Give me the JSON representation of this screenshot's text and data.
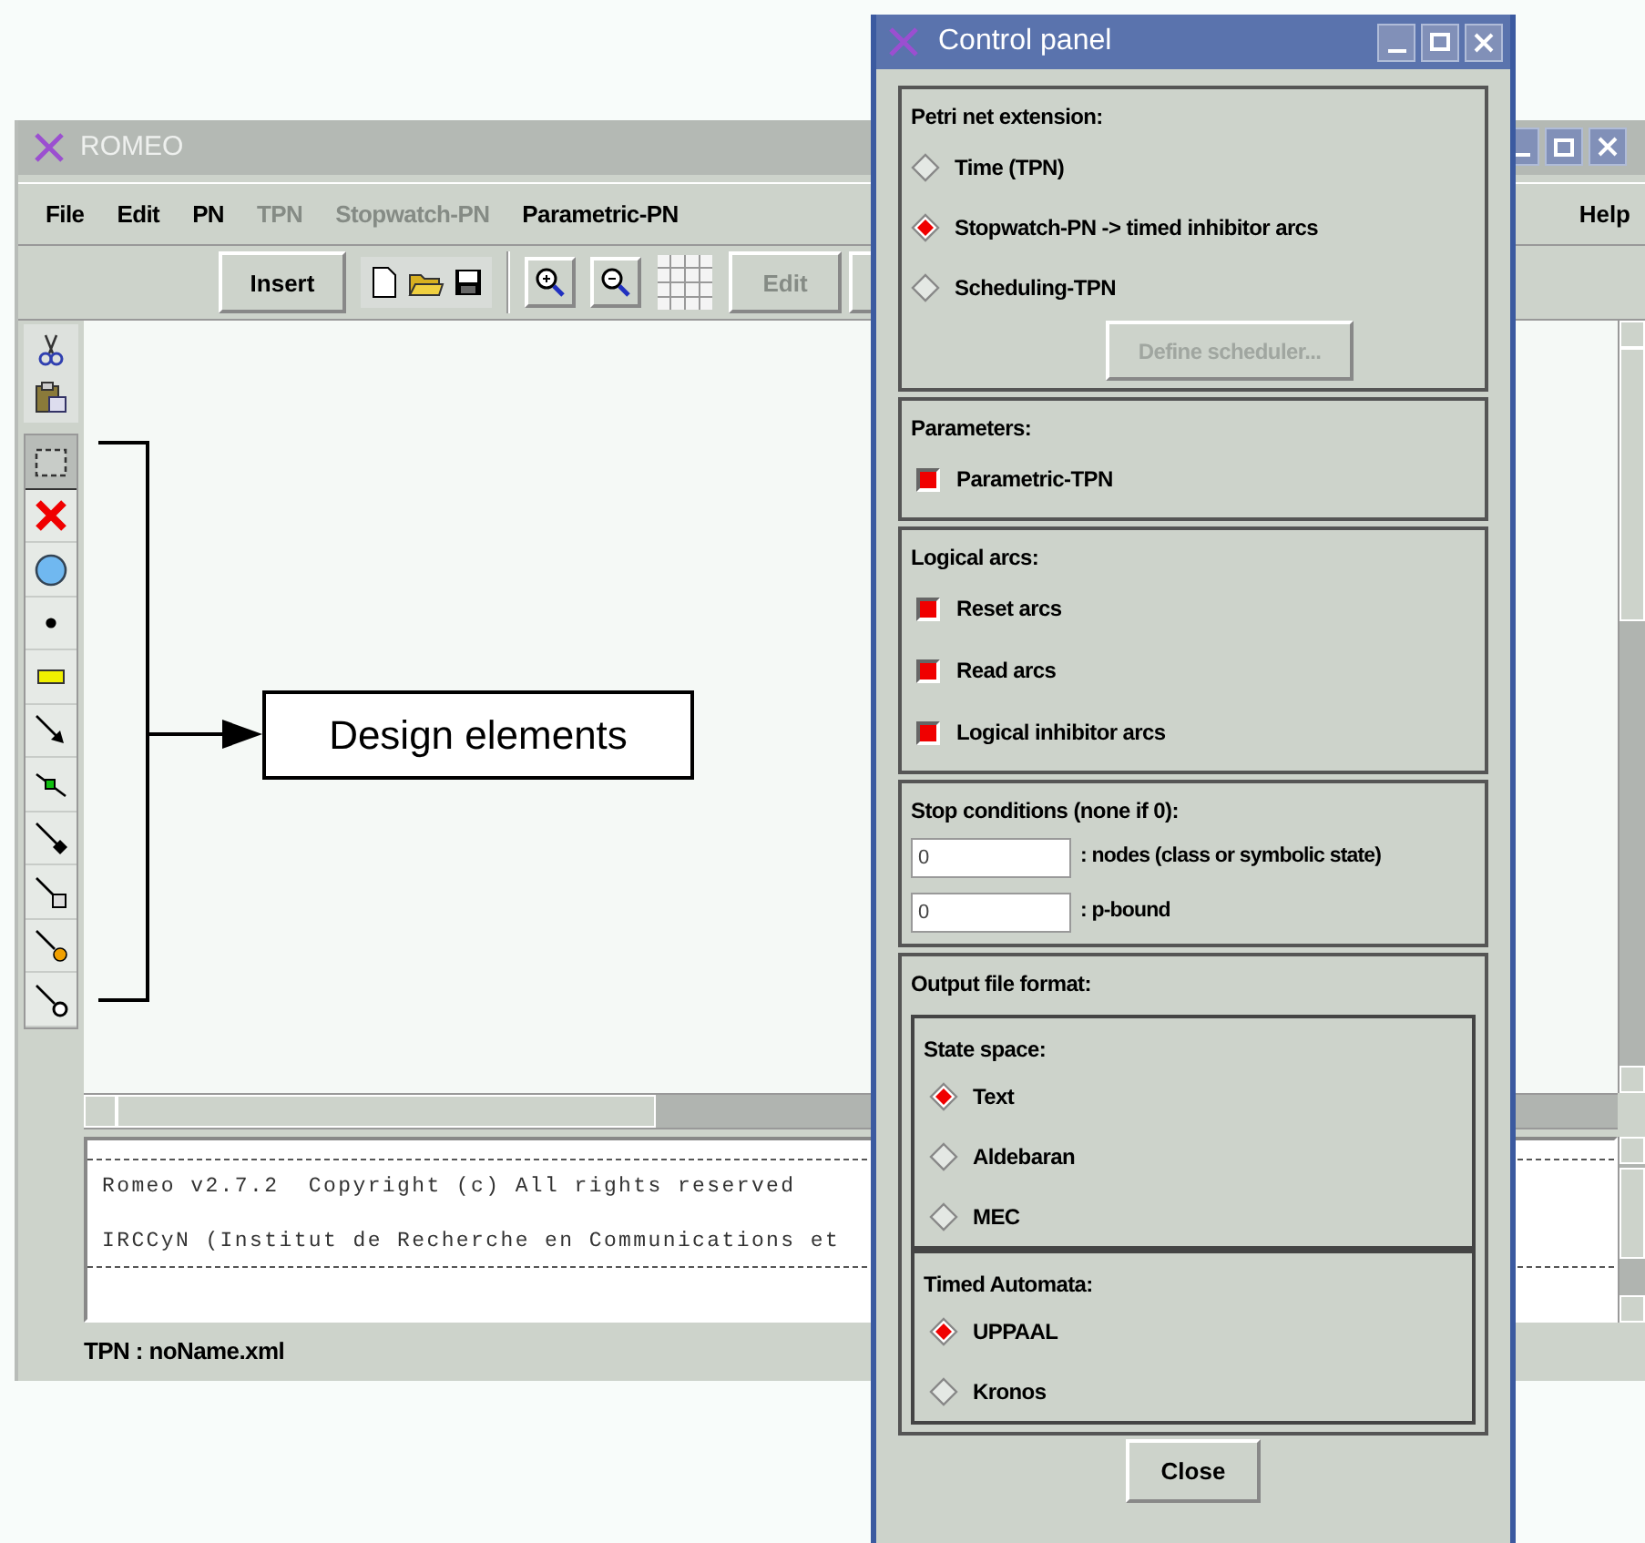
{
  "romeo": {
    "title": "ROMEO",
    "menu": [
      {
        "label": "File",
        "disabled": false
      },
      {
        "label": "Edit",
        "disabled": false
      },
      {
        "label": "PN",
        "disabled": false
      },
      {
        "label": "TPN",
        "disabled": true
      },
      {
        "label": "Stopwatch-PN",
        "disabled": true
      },
      {
        "label": "Parametric-PN",
        "disabled": false
      }
    ],
    "help_menu": "Help",
    "toolbar": {
      "insert": "Insert",
      "edit": {
        "label": "Edit",
        "disabled": true
      }
    },
    "edit_tools": [
      {
        "kind": "cut"
      },
      {
        "kind": "paste"
      }
    ],
    "design_tools": [
      {
        "kind": "select",
        "selected": true
      },
      {
        "kind": "delete",
        "selected": false
      },
      {
        "kind": "place",
        "selected": false
      },
      {
        "kind": "token",
        "selected": false
      },
      {
        "kind": "transition",
        "selected": false
      },
      {
        "kind": "arc",
        "selected": false
      },
      {
        "kind": "read_arc",
        "selected": false
      },
      {
        "kind": "diamond_arc",
        "selected": false
      },
      {
        "kind": "square_arc",
        "selected": false
      },
      {
        "kind": "orange_arc",
        "selected": false
      },
      {
        "kind": "hollow_arc",
        "selected": false
      }
    ],
    "console": [
      "Romeo v2.7.2  Copyright (c) All rights reserved",
      "IRCCyN (Institut de Recherche en Communications et"
    ],
    "status": "TPN : noName.xml"
  },
  "annotation": {
    "label": "Design elements"
  },
  "control_panel": {
    "title": "Control panel",
    "sections": [
      {
        "kind": "options",
        "title": "Petri net extension:",
        "items": [
          {
            "kind": "radio",
            "label": "Time (TPN)",
            "selected": false
          },
          {
            "kind": "radio",
            "label": "Stopwatch-PN -> timed inhibitor arcs",
            "selected": true
          },
          {
            "kind": "radio",
            "label": "Scheduling-TPN",
            "selected": false
          }
        ],
        "button": {
          "label": "Define scheduler...",
          "disabled": true
        }
      },
      {
        "kind": "options",
        "title": "Parameters:",
        "items": [
          {
            "kind": "checkbox",
            "label": "Parametric-TPN",
            "checked": true
          }
        ]
      },
      {
        "kind": "options",
        "title": "Logical arcs:",
        "items": [
          {
            "kind": "checkbox",
            "label": "Reset arcs",
            "checked": true
          },
          {
            "kind": "checkbox",
            "label": "Read arcs",
            "checked": true
          },
          {
            "kind": "checkbox",
            "label": "Logical inhibitor arcs",
            "checked": true
          }
        ]
      },
      {
        "kind": "fields",
        "title": "Stop conditions (none if 0):",
        "fields": [
          {
            "value": "0",
            "label": ": nodes (class or symbolic state)"
          },
          {
            "value": "0",
            "label": ": p-bound"
          }
        ]
      },
      {
        "kind": "groups",
        "title": "Output file format:",
        "groups": [
          {
            "title": "State space:",
            "items": [
              {
                "kind": "radio",
                "label": "Text",
                "selected": true
              },
              {
                "kind": "radio",
                "label": "Aldebaran",
                "selected": false
              },
              {
                "kind": "radio",
                "label": "MEC",
                "selected": false
              }
            ]
          },
          {
            "title": "Timed Automata:",
            "items": [
              {
                "kind": "radio",
                "label": "UPPAAL",
                "selected": true
              },
              {
                "kind": "radio",
                "label": "Kronos",
                "selected": false
              }
            ]
          }
        ]
      }
    ],
    "close": "Close"
  }
}
